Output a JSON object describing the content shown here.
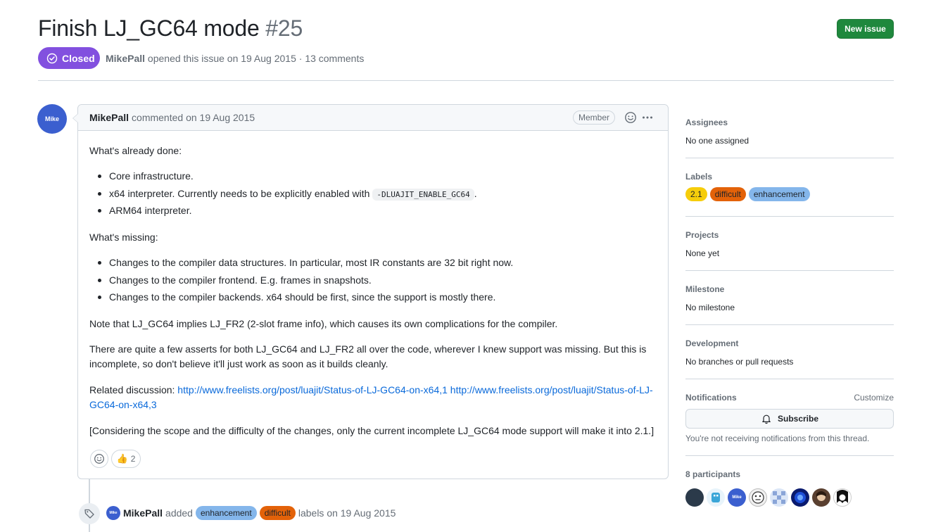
{
  "issue": {
    "title": "Finish LJ_GC64 mode",
    "number": "#25",
    "state": "Closed",
    "author": "MikePall",
    "meta_text": "opened this issue on 19 Aug 2015 · 13 comments",
    "new_issue_label": "New issue"
  },
  "comment": {
    "author": "MikePall",
    "avatar_text": "Mike",
    "meta": "commented on 19 Aug 2015",
    "badge": "Member",
    "done_heading": "What's already done:",
    "done_items": [
      "Core infrastructure.",
      "x64 interpreter. Currently needs to be explicitly enabled with",
      "ARM64 interpreter."
    ],
    "done_code": "-DLUAJIT_ENABLE_GC64",
    "done_suffix": ".",
    "missing_heading": "What's missing:",
    "missing_items": [
      "Changes to the compiler data structures. In particular, most IR constants are 32 bit right now.",
      "Changes to the compiler frontend. E.g. frames in snapshots.",
      "Changes to the compiler backends. x64 should be first, since the support is mostly there."
    ],
    "note": "Note that LJ_GC64 implies LJ_FR2 (2-slot frame info), which causes its own complications for the compiler.",
    "asserts": "There are quite a few asserts for both LJ_GC64 and LJ_FR2 all over the code, wherever I knew support was missing. But this is incomplete, so don't believe it'll just work as soon as it builds cleanly.",
    "related_label": "Related discussion:",
    "link1": "http://www.freelists.org/post/luajit/Status-of-LJ-GC64-on-x64,1",
    "link2": "http://www.freelists.org/post/luajit/Status-of-LJ-GC64-on-x64,3",
    "scope": "[Considering the scope and the difficulty of the changes, only the current incomplete LJ_GC64 mode support will make it into 2.1.]",
    "thumbs_count": "2"
  },
  "event": {
    "author": "MikePall",
    "avatar_text": "Mike",
    "action": "added",
    "labels": [
      "enhancement",
      "difficult"
    ],
    "suffix": "labels on 19 Aug 2015"
  },
  "sidebar": {
    "assignees": {
      "heading": "Assignees",
      "value": "No one assigned"
    },
    "labels": {
      "heading": "Labels",
      "items": [
        "2.1",
        "difficult",
        "enhancement"
      ]
    },
    "projects": {
      "heading": "Projects",
      "value": "None yet"
    },
    "milestone": {
      "heading": "Milestone",
      "value": "No milestone"
    },
    "development": {
      "heading": "Development",
      "value": "No branches or pull requests"
    },
    "notifications": {
      "heading": "Notifications",
      "customize": "Customize",
      "subscribe": "Subscribe",
      "note": "You're not receiving notifications from this thread."
    },
    "participants": {
      "heading": "8 participants",
      "count": 8
    }
  },
  "colors": {
    "closed": "#8250df",
    "new_issue": "#1f883d",
    "link": "#0969da",
    "label_2_1": "#f6cd0b",
    "label_difficult": "#e36209",
    "label_enhancement": "#84b6eb"
  }
}
